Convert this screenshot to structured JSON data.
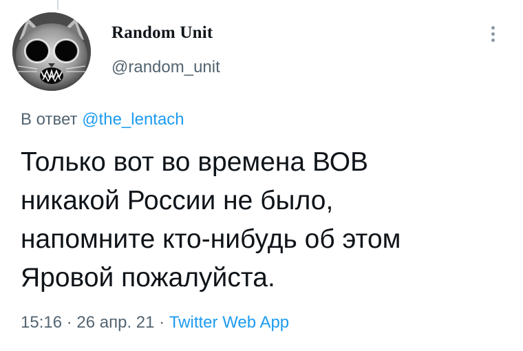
{
  "author": {
    "display_name": "Random Unit",
    "handle": "@random_unit"
  },
  "reply": {
    "prefix": "В ответ",
    "mention": "@the_lentach"
  },
  "tweet": {
    "lines": [
      "Только вот во времена ВОВ",
      "никакой России не было,",
      "напомните кто-нибудь об этом",
      "Яровой пожалуйста."
    ]
  },
  "meta": {
    "time": "15:16",
    "date": "26 апр. 21",
    "separator": "·",
    "source": "Twitter Web App"
  },
  "icons": {
    "more": "more-vertical-icon",
    "avatar": "cat-avatar-image"
  },
  "colors": {
    "accent": "#1d9bf0",
    "secondary_text": "#536471",
    "primary_text": "#0f1419"
  }
}
